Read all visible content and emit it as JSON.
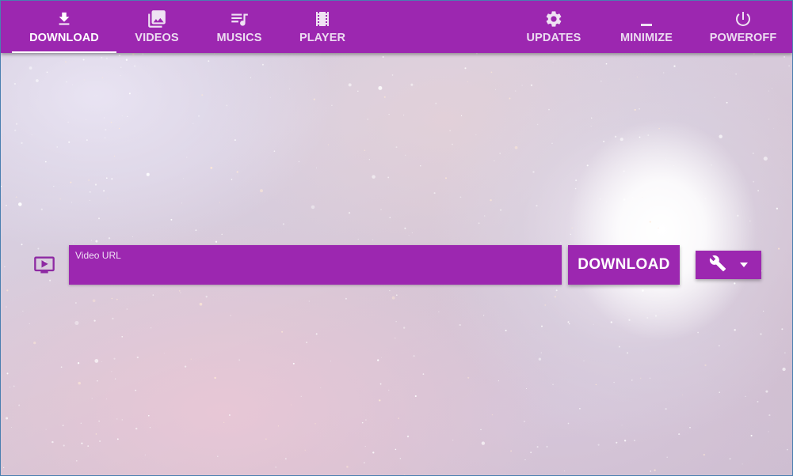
{
  "colors": {
    "primary": "#9c27b0",
    "tab_text": "#ecdcf1",
    "active": "#ffffff"
  },
  "nav": {
    "tabs": [
      {
        "label": "DOWNLOAD",
        "icon": "download-icon",
        "active": true
      },
      {
        "label": "VIDEOS",
        "icon": "photo-library-icon",
        "active": false
      },
      {
        "label": "MUSICS",
        "icon": "queue-music-icon",
        "active": false
      },
      {
        "label": "PLAYER",
        "icon": "film-icon",
        "active": false
      }
    ],
    "actions": [
      {
        "label": "UPDATES",
        "icon": "gear-icon"
      },
      {
        "label": "MINIMIZE",
        "icon": "minimize-icon"
      },
      {
        "label": "POWEROFF",
        "icon": "power-icon"
      }
    ]
  },
  "download_form": {
    "field_icon": "ondemand-video-icon",
    "url_label": "Video URL",
    "url_value": "",
    "download_button": "DOWNLOAD",
    "tools_icon": "wrench-icon",
    "dropdown_icon": "caret-down-icon"
  }
}
